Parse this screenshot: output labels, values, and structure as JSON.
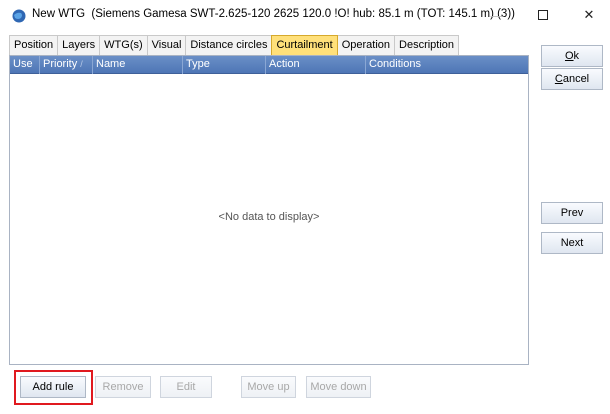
{
  "window": {
    "title": "New WTG",
    "subtitle": "(Siemens Gamesa SWT-2.625-120 2625 120.0 !O! hub: 85.1 m (TOT: 145.1 m) (3))",
    "minimize_glyph": "—",
    "close_glyph": "✕"
  },
  "tabs": [
    {
      "label": "Position"
    },
    {
      "label": "Layers"
    },
    {
      "label": "WTG(s)"
    },
    {
      "label": "Visual"
    },
    {
      "label": "Distance circles"
    },
    {
      "label": "Curtailment",
      "active": true
    },
    {
      "label": "Operation"
    },
    {
      "label": "Description"
    }
  ],
  "grid": {
    "columns": [
      "Use",
      "Priority",
      "Name",
      "Type",
      "Action",
      "Conditions"
    ],
    "sort_glyph": "/",
    "empty_text": "<No data to display>"
  },
  "bottom_buttons": {
    "add_rule": "Add rule",
    "remove": "Remove",
    "edit": "Edit",
    "move_up": "Move up",
    "move_down": "Move down"
  },
  "side_buttons": {
    "ok_first": "O",
    "ok_rest": "k",
    "cancel_first": "C",
    "cancel_rest": "ancel",
    "prev": "Prev",
    "next": "Next"
  },
  "colors": {
    "active_tab": "#ffe07a",
    "grid_header": "#5a80bd",
    "highlight": "#e0191f"
  }
}
